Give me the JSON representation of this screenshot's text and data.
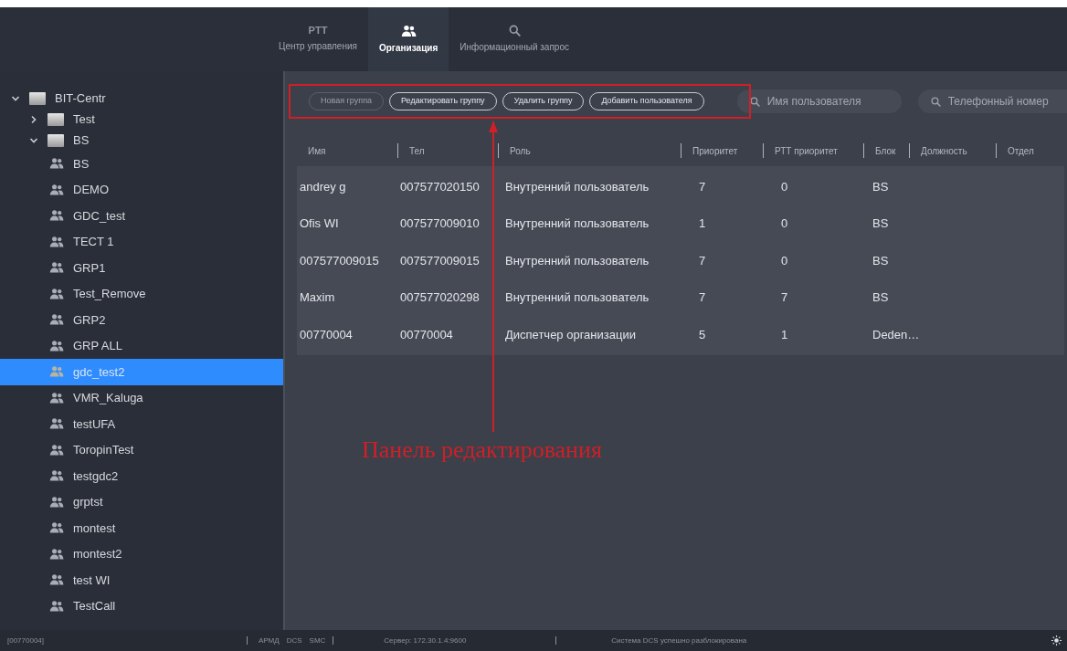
{
  "header": {
    "tabs": [
      {
        "kind": "text",
        "top": "PTT",
        "label": "Центр управления",
        "selected": false
      },
      {
        "kind": "people",
        "label": "Организация",
        "selected": true
      },
      {
        "kind": "search",
        "label": "Информационный запрос",
        "selected": false
      }
    ]
  },
  "tree": [
    {
      "kind": "folder",
      "label": "BIT-Centr",
      "expanded": true,
      "selected": false,
      "children": [
        {
          "kind": "folder",
          "label": "Test",
          "expanded": false,
          "selected": false
        },
        {
          "kind": "folder",
          "label": "BS",
          "expanded": true,
          "selected": false,
          "children": [
            {
              "kind": "group",
              "label": "BS",
              "selected": false
            },
            {
              "kind": "group",
              "label": "DEMO",
              "selected": false
            },
            {
              "kind": "group",
              "label": "GDC_test",
              "selected": false
            },
            {
              "kind": "group",
              "label": "TECT 1",
              "selected": false
            },
            {
              "kind": "group",
              "label": "GRP1",
              "selected": false
            },
            {
              "kind": "group",
              "label": "Test_Remove",
              "selected": false
            },
            {
              "kind": "group",
              "label": "GRP2",
              "selected": false
            },
            {
              "kind": "group",
              "label": "GRP ALL",
              "selected": false
            },
            {
              "kind": "group",
              "label": "gdc_test2",
              "selected": true
            },
            {
              "kind": "group",
              "label": "VMR_Kaluga",
              "selected": false
            },
            {
              "kind": "group",
              "label": "testUFA",
              "selected": false
            },
            {
              "kind": "group",
              "label": "ToropinTest",
              "selected": false
            },
            {
              "kind": "group",
              "label": "testgdc2",
              "selected": false
            },
            {
              "kind": "group",
              "label": "grptst",
              "selected": false
            },
            {
              "kind": "group",
              "label": "montest",
              "selected": false
            },
            {
              "kind": "group",
              "label": "montest2",
              "selected": false
            },
            {
              "kind": "group",
              "label": "test WI",
              "selected": false
            },
            {
              "kind": "group",
              "label": "TestCall",
              "selected": false
            }
          ]
        }
      ]
    }
  ],
  "toolbar": {
    "buttons": [
      {
        "label": "Новая группа",
        "disabled": true
      },
      {
        "label": "Редактировать группу",
        "disabled": false
      },
      {
        "label": "Удалить группу",
        "disabled": false
      },
      {
        "label": "Добавить пользователя",
        "disabled": false
      }
    ],
    "search_fields": [
      {
        "placeholder": "Имя пользователя"
      },
      {
        "placeholder": "Телефонный номер"
      }
    ]
  },
  "table": {
    "columns": [
      "Имя",
      "Тел",
      "Роль",
      "Приоритет",
      "РТТ приоритет",
      "Блок",
      "Должность",
      "Отдел"
    ],
    "rows": [
      [
        "andrey g",
        "007577020150",
        "Внутренний пользователь",
        "7",
        "0",
        "BS"
      ],
      [
        "Ofis WI",
        "007577009010",
        "Внутренний пользователь",
        "1",
        "0",
        "BS"
      ],
      [
        "007577009015",
        "007577009015",
        "Внутренний пользователь",
        "7",
        "0",
        "BS"
      ],
      [
        "Maxim",
        "007577020298",
        "Внутренний пользователь",
        "7",
        "7",
        "BS"
      ],
      [
        "00770004",
        "00770004",
        "Диспетчер организации",
        "5",
        "1",
        "Deden…"
      ]
    ]
  },
  "annotation": {
    "label": "Панель редактирования"
  },
  "status_bar": {
    "items": [
      "[00770004]",
      "АРМД",
      "DCS",
      "SMC",
      "Сервер: 172.30.1.4:9600",
      "Система DCS успешно разблокирована"
    ]
  }
}
